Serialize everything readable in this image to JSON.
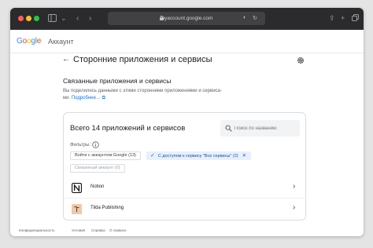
{
  "browser": {
    "url": "myaccount.google.com"
  },
  "header": {
    "brand_google": "Google",
    "brand_account": "Аккаунт",
    "colors": {
      "blue": "#4285F4",
      "red": "#EA4335",
      "yellow": "#FBBC05",
      "green": "#34A853"
    }
  },
  "page": {
    "title": "Сторонние приложения и сервисы"
  },
  "section": {
    "title": "Связанные приложения и сервисы",
    "description_line1": "Вы поделились данными с этими сторонними приложениями и сервиса-",
    "description_line2": "ми.",
    "more_link": "Подробнее…"
  },
  "card": {
    "title": "Всего 14 приложений и сервисов",
    "search_placeholder": "Поиск по названию",
    "filters_label": "Фильтры:",
    "chips": [
      {
        "label": "Войти с аккаунтом Google (13)",
        "selected": false
      },
      {
        "label": "С доступом к сервису \"Все сервисы\" (2)",
        "selected": true
      },
      {
        "label": "Связанный аккаунт (0)",
        "selected": false,
        "disabled": true
      }
    ],
    "apps": [
      {
        "name": "Notion",
        "icon": "notion-logo"
      },
      {
        "name": "Tilda Publishing",
        "icon": "tilda-logo"
      }
    ]
  },
  "footer": {
    "links": [
      "Конфиденциальность",
      "Условия",
      "Справка",
      "О сервисе"
    ]
  }
}
